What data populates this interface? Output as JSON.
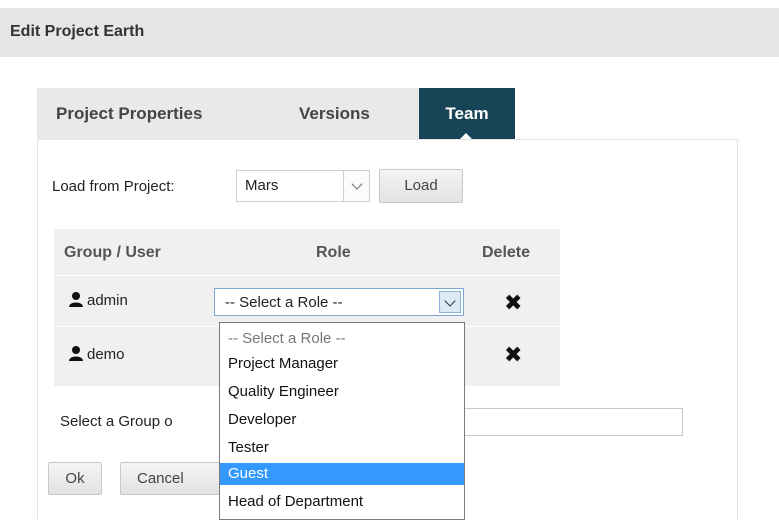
{
  "header": {
    "title": "Edit Project Earth"
  },
  "tabs": [
    {
      "label": "Project Properties",
      "active": false
    },
    {
      "label": "Versions",
      "active": false
    },
    {
      "label": "Team",
      "active": true
    }
  ],
  "load_from": {
    "label": "Load from Project:",
    "selected": "Mars",
    "button": "Load"
  },
  "table": {
    "headers": [
      "Group / User",
      "Role",
      "Delete"
    ],
    "rows": [
      {
        "user": "admin",
        "role": "-- Select a Role --",
        "user_icon": "user-icon",
        "delete_icon": "close-icon"
      },
      {
        "user": "demo",
        "role": "",
        "user_icon": "user-icon",
        "delete_icon": "close-icon"
      }
    ]
  },
  "role_dropdown": {
    "options": [
      "-- Select a Role --",
      "Project Manager",
      "Quality Engineer",
      "Developer",
      "Tester",
      "Guest",
      "Head of Department"
    ],
    "highlighted": "Guest"
  },
  "select_group": {
    "label": "Select a Group o",
    "input_value": ""
  },
  "buttons": {
    "ok": "Ok",
    "cancel": "Cancel"
  },
  "colors": {
    "active_tab": "#184457",
    "highlight": "#3399ff",
    "table_bg": "#f0f0f0"
  }
}
